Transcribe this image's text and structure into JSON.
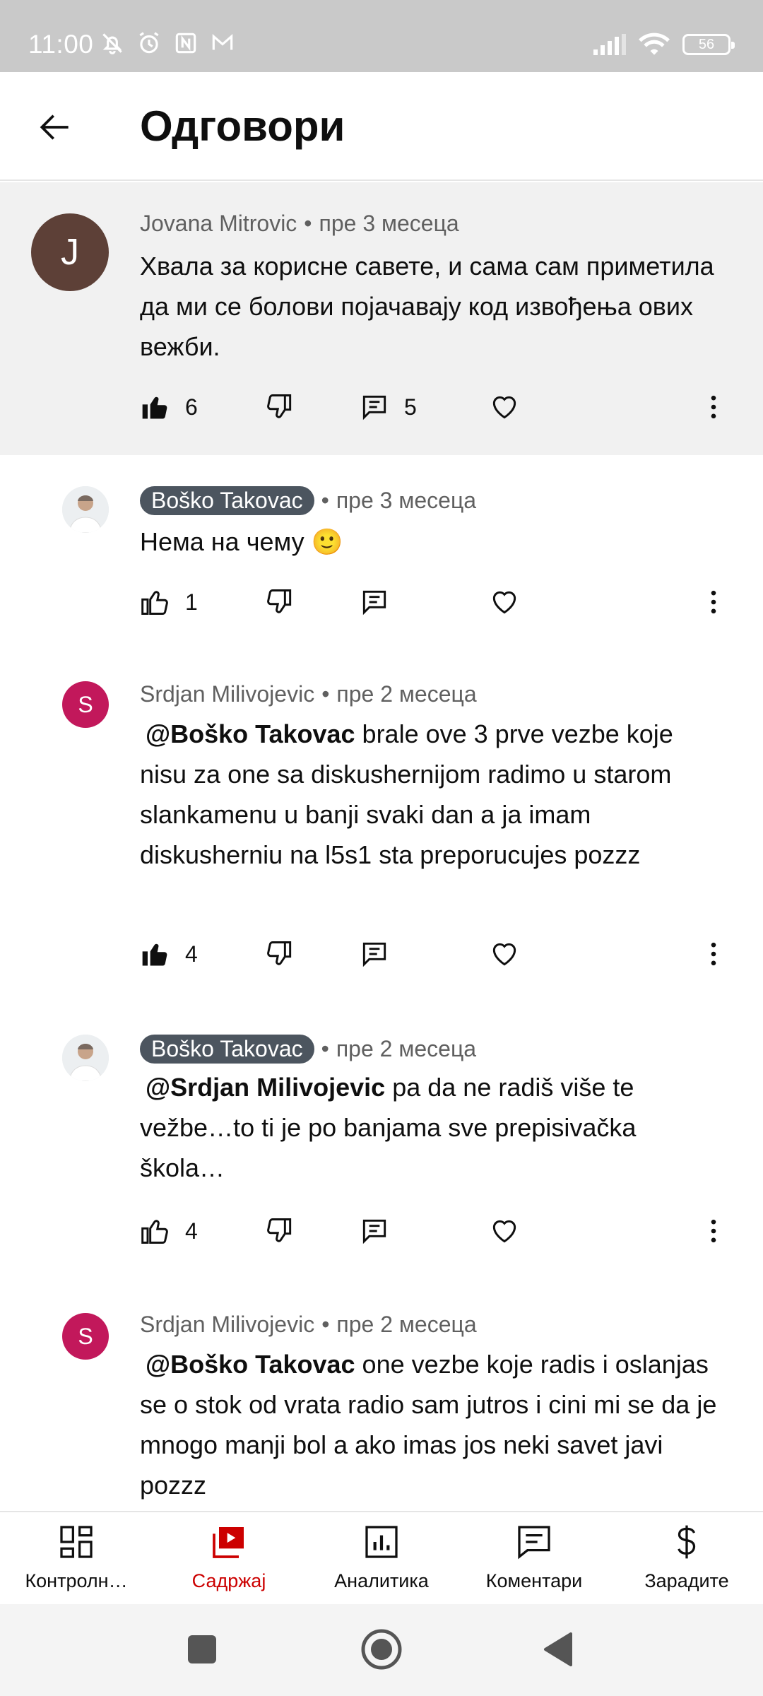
{
  "status_bar": {
    "time": "11:00",
    "battery": "56"
  },
  "header": {
    "title": "Одговори"
  },
  "comments": [
    {
      "author": "Jovana Mitrovic",
      "time": "пре 3 месеца",
      "avatar_letter": "J",
      "avatar_color": "#5d4037",
      "text": "Хвала за корисне савете, и сама сам приметила да ми се болови појачавају код извођења ових вежби.",
      "likes": "6",
      "replies": "5"
    },
    {
      "author": "Boško Takovac",
      "time": "пре 3 месеца",
      "text": "Нема на чему 🙂",
      "likes": "1"
    },
    {
      "author": "Srdjan Milivojevic",
      "time": "пре 2 месеца",
      "avatar_letter": "S",
      "avatar_color": "#c2185b",
      "mention": "@Boško Takovac",
      "text": "brale  ove 3 prve vezbe koje nisu za one sa diskushernijom radimo u starom slankamenu u banji svaki dan a ja imam diskusherniu na l5s1 sta preporucujes pozzz",
      "likes": "4"
    },
    {
      "author": "Boško Takovac",
      "time": "пре 2 месеца",
      "mention": "@Srdjan Milivojevic",
      "text": "pa da ne radiš više te vežbe…to ti je po banjama sve prepisivačka škola…",
      "likes": "4"
    },
    {
      "author": "Srdjan Milivojevic",
      "time": "пре 2 месеца",
      "avatar_letter": "S",
      "avatar_color": "#c2185b",
      "mention": "@Boško Takovac",
      "text": "one vezbe koje radis i oslanjas se o stok od vrata radio sam jutros i cini mi se da je mnogo manji bol a ako imas jos neki savet javi pozzz"
    }
  ],
  "bottom_nav": [
    {
      "label": "Контролн…",
      "icon": "dashboard-icon"
    },
    {
      "label": "Садржај",
      "icon": "content-icon",
      "active": true
    },
    {
      "label": "Аналитика",
      "icon": "analytics-icon"
    },
    {
      "label": "Коментари",
      "icon": "comments-icon"
    },
    {
      "label": "Зарадите",
      "icon": "earn-icon"
    }
  ],
  "colors": {
    "accent": "#cc0000",
    "highlight_bg": "#f1f1f1",
    "chip_bg": "#4c555f"
  }
}
